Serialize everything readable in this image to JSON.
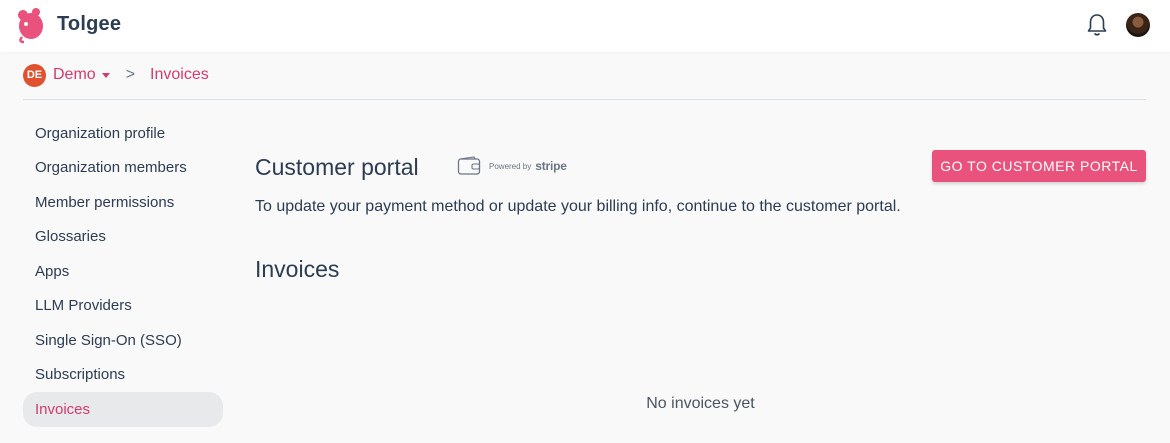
{
  "app": {
    "name": "Tolgee"
  },
  "header": {
    "logo_icon": "tolgee-mouse-logo",
    "bell_icon": "bell-icon",
    "user_avatar": "user-avatar",
    "accent_color": "#d33a70"
  },
  "breadcrumb": {
    "org_initials": "DE",
    "org_name": "Demo",
    "separator": ">",
    "current": "Invoices"
  },
  "sidebar": {
    "items": [
      {
        "label": "Organization profile",
        "active": false
      },
      {
        "label": "Organization members",
        "active": false
      },
      {
        "label": "Member permissions",
        "active": false
      },
      {
        "label": "Glossaries",
        "active": false
      },
      {
        "label": "Apps",
        "active": false
      },
      {
        "label": "LLM Providers",
        "active": false
      },
      {
        "label": "Single Sign-On (SSO)",
        "active": false
      },
      {
        "label": "Subscriptions",
        "active": false
      },
      {
        "label": "Invoices",
        "active": true
      }
    ]
  },
  "main": {
    "portal_title": "Customer portal",
    "stripe_badge": {
      "powered_by": "Powered by",
      "brand": "stripe"
    },
    "portal_button": "GO TO CUSTOMER PORTAL",
    "portal_description": "To update your payment method or update your billing info, continue to the customer portal.",
    "invoices_title": "Invoices",
    "empty_text": "No invoices yet"
  }
}
